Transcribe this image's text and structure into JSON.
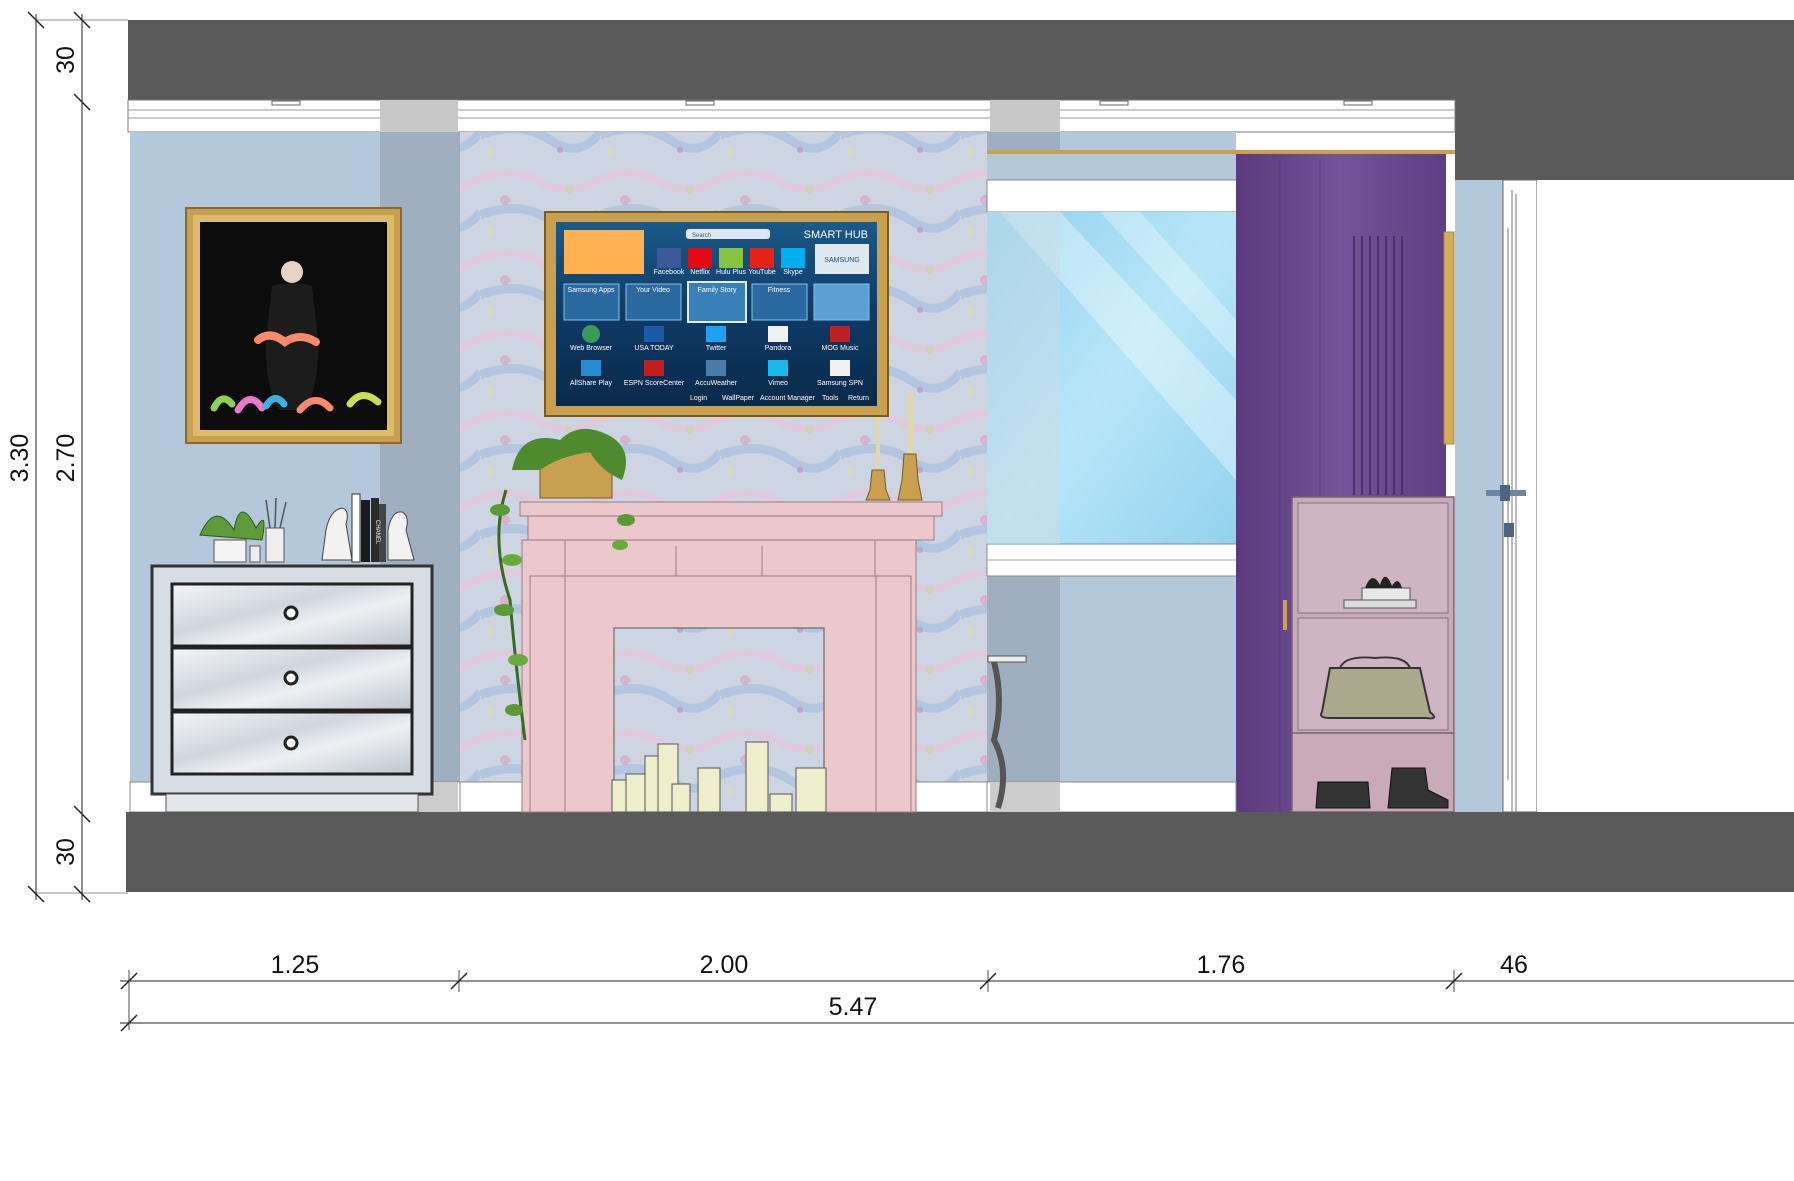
{
  "dimensions": {
    "vertical": {
      "total": "3.30",
      "wall": "2.70",
      "ceiling": "30",
      "floor": "30"
    },
    "horizontal": {
      "dresser_bay": "1.25",
      "fireplace_bay": "2.00",
      "window_bay": "1.76",
      "door_bay": "46",
      "total": "5.47"
    }
  },
  "tv": {
    "brand_title": "SMART HUB",
    "search_label": "Search",
    "apps_row1": [
      "Facebook",
      "Netflix",
      "Hulu Plus",
      "YouTube",
      "Skype"
    ],
    "samsung_badge": "SAMSUNG",
    "panel_tabs": [
      "Samsung Apps",
      "Your Video",
      "Family Story",
      "Fitness"
    ],
    "apps_row3": [
      "Web Browser",
      "USA TODAY",
      "Twitter",
      "Pandora",
      "MOG Music"
    ],
    "apps_row4": [
      "AllShare Play",
      "ESPN ScoreCenter",
      "AccuWeather",
      "Vimeo",
      "Samsung SPN"
    ],
    "footer_items": [
      "Login",
      "WallPaper",
      "Account Manager",
      "Tools",
      "Return"
    ]
  },
  "books": {
    "spine_text": "CHANEL"
  },
  "colors": {
    "wall_blue": "#b4c8dc",
    "slab_grey": "#5a5a5a",
    "curtain_purple": "#6a4a8c",
    "fireplace_pink": "#ebc8cc",
    "frame_gold": "#c8a050",
    "cabinet_mauve": "#c8aab8"
  }
}
